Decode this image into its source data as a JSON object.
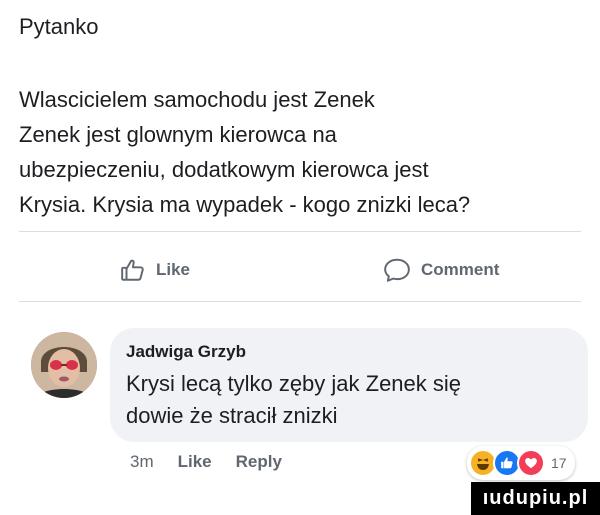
{
  "post": {
    "author": "Pytanko",
    "lines": [
      "Wlascicielem samochodu jest Zenek",
      "Zenek jest glownym kierowca na",
      "ubezpieczeniu, dodatkowym kierowca jest",
      "Krysia. Krysia ma wypadek - kogo znizki leca?"
    ]
  },
  "actions": {
    "like_label": "Like",
    "comment_label": "Comment"
  },
  "comment": {
    "author": "Jadwiga Grzyb",
    "lines": [
      "Krysi lecą tylko zęby jak Zenek się",
      "dowie że stracił znizki"
    ],
    "time": "3m",
    "like_label": "Like",
    "reply_label": "Reply",
    "reaction_count": "17",
    "reaction_icons": [
      "haha-icon",
      "like-icon",
      "love-icon"
    ]
  },
  "watermark": "ıudupiu.pl",
  "colors": {
    "like_blue": "#1877f2",
    "love_red": "#f33e58",
    "haha_yellow": "#f7b125",
    "secondary_text": "#606770",
    "bubble_bg": "#f0f2f5"
  }
}
